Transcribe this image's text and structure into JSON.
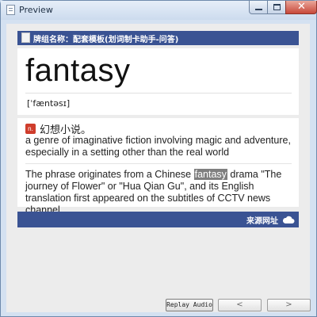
{
  "window": {
    "title": "Preview"
  },
  "deck": {
    "label": "牌组名称：配套模板(划词制卡助手-问答)"
  },
  "card": {
    "word": "fantasy",
    "phonetic": "[ˈfæntəsɪ]",
    "definition": {
      "pos": "n.",
      "zh": "幻想小说。",
      "en": "a genre of imaginative fiction involving magic and adventure, especially in a setting other than the real world"
    },
    "example": {
      "before": "The phrase originates from a Chinese ",
      "highlight": "fantasy",
      "after": " drama \"The journey of Flower\" or \"Hua Qian Gu\", and its English translation first appeared on the subtitles of CCTV news channel."
    }
  },
  "source": {
    "label": "来源网址",
    "icon": "cloud-icon"
  },
  "footer": {
    "replay_label": "Replay Audio",
    "prev_label": "<",
    "next_label": ">"
  },
  "colors": {
    "bar": "#3a5393",
    "badge": "#cf3d2c",
    "highlight": "#7f7f7f"
  }
}
